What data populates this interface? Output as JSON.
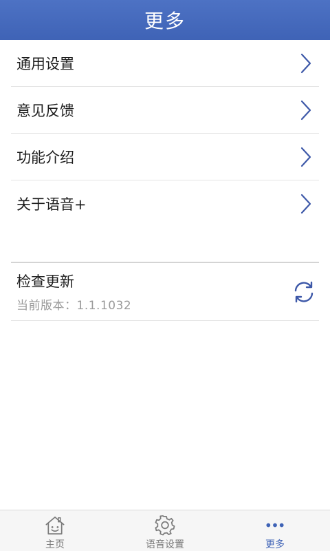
{
  "header": {
    "title": "更多"
  },
  "menu": {
    "items": [
      {
        "label": "通用设置"
      },
      {
        "label": "意见反馈"
      },
      {
        "label": "功能介绍"
      },
      {
        "label": "关于语音+"
      }
    ]
  },
  "update": {
    "title": "检查更新",
    "version": "当前版本：1.1.1032"
  },
  "tabbar": {
    "tabs": [
      {
        "label": "主页",
        "icon": "home-icon"
      },
      {
        "label": "语音设置",
        "icon": "gear-icon"
      },
      {
        "label": "更多",
        "icon": "more-dots-icon",
        "active": true
      }
    ]
  },
  "colors": {
    "accent": "#3f63b6",
    "header": "#4466bb",
    "chevron": "#3d58a8"
  }
}
